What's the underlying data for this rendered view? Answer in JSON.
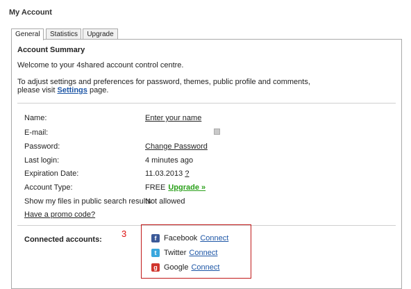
{
  "header": {
    "title": "My Account"
  },
  "tabs": [
    {
      "label": "General",
      "active": true
    },
    {
      "label": "Statistics",
      "active": false
    },
    {
      "label": "Upgrade",
      "active": false
    }
  ],
  "summary": {
    "title": "Account Summary",
    "welcome": "Welcome to your 4shared account control centre.",
    "adjust_line1": "To adjust settings and preferences for password, themes, public profile and comments,",
    "adjust_line2_prefix": "please visit ",
    "settings_link": "Settings",
    "adjust_line2_suffix": " page."
  },
  "fields": {
    "name_label": "Name:",
    "name_value": "Enter your name",
    "email_label": "E-mail:",
    "password_label": "Password:",
    "password_value": "Change Password",
    "last_login_label": "Last login:",
    "last_login_value": "4 minutes ago",
    "expiration_label": "Expiration Date:",
    "expiration_value": "11.03.2013",
    "expiration_help": "?",
    "account_type_label": "Account Type:",
    "account_type_value": "FREE",
    "upgrade_link": "Upgrade »",
    "public_search_label": "Show my files in public search results:",
    "public_search_value": "Not allowed",
    "promo_link": "Have a promo code?"
  },
  "connected": {
    "label": "Connected accounts:",
    "marker": "3",
    "services": [
      {
        "name": "Facebook",
        "action": "Connect",
        "icon": "facebook-icon",
        "glyph": "f",
        "color": "#3b5998"
      },
      {
        "name": "Twitter",
        "action": "Connect",
        "icon": "twitter-icon",
        "glyph": "t",
        "color": "#3aa7dd"
      },
      {
        "name": "Google",
        "action": "Connect",
        "icon": "google-icon",
        "glyph": "g",
        "color": "#d0342c"
      }
    ]
  }
}
